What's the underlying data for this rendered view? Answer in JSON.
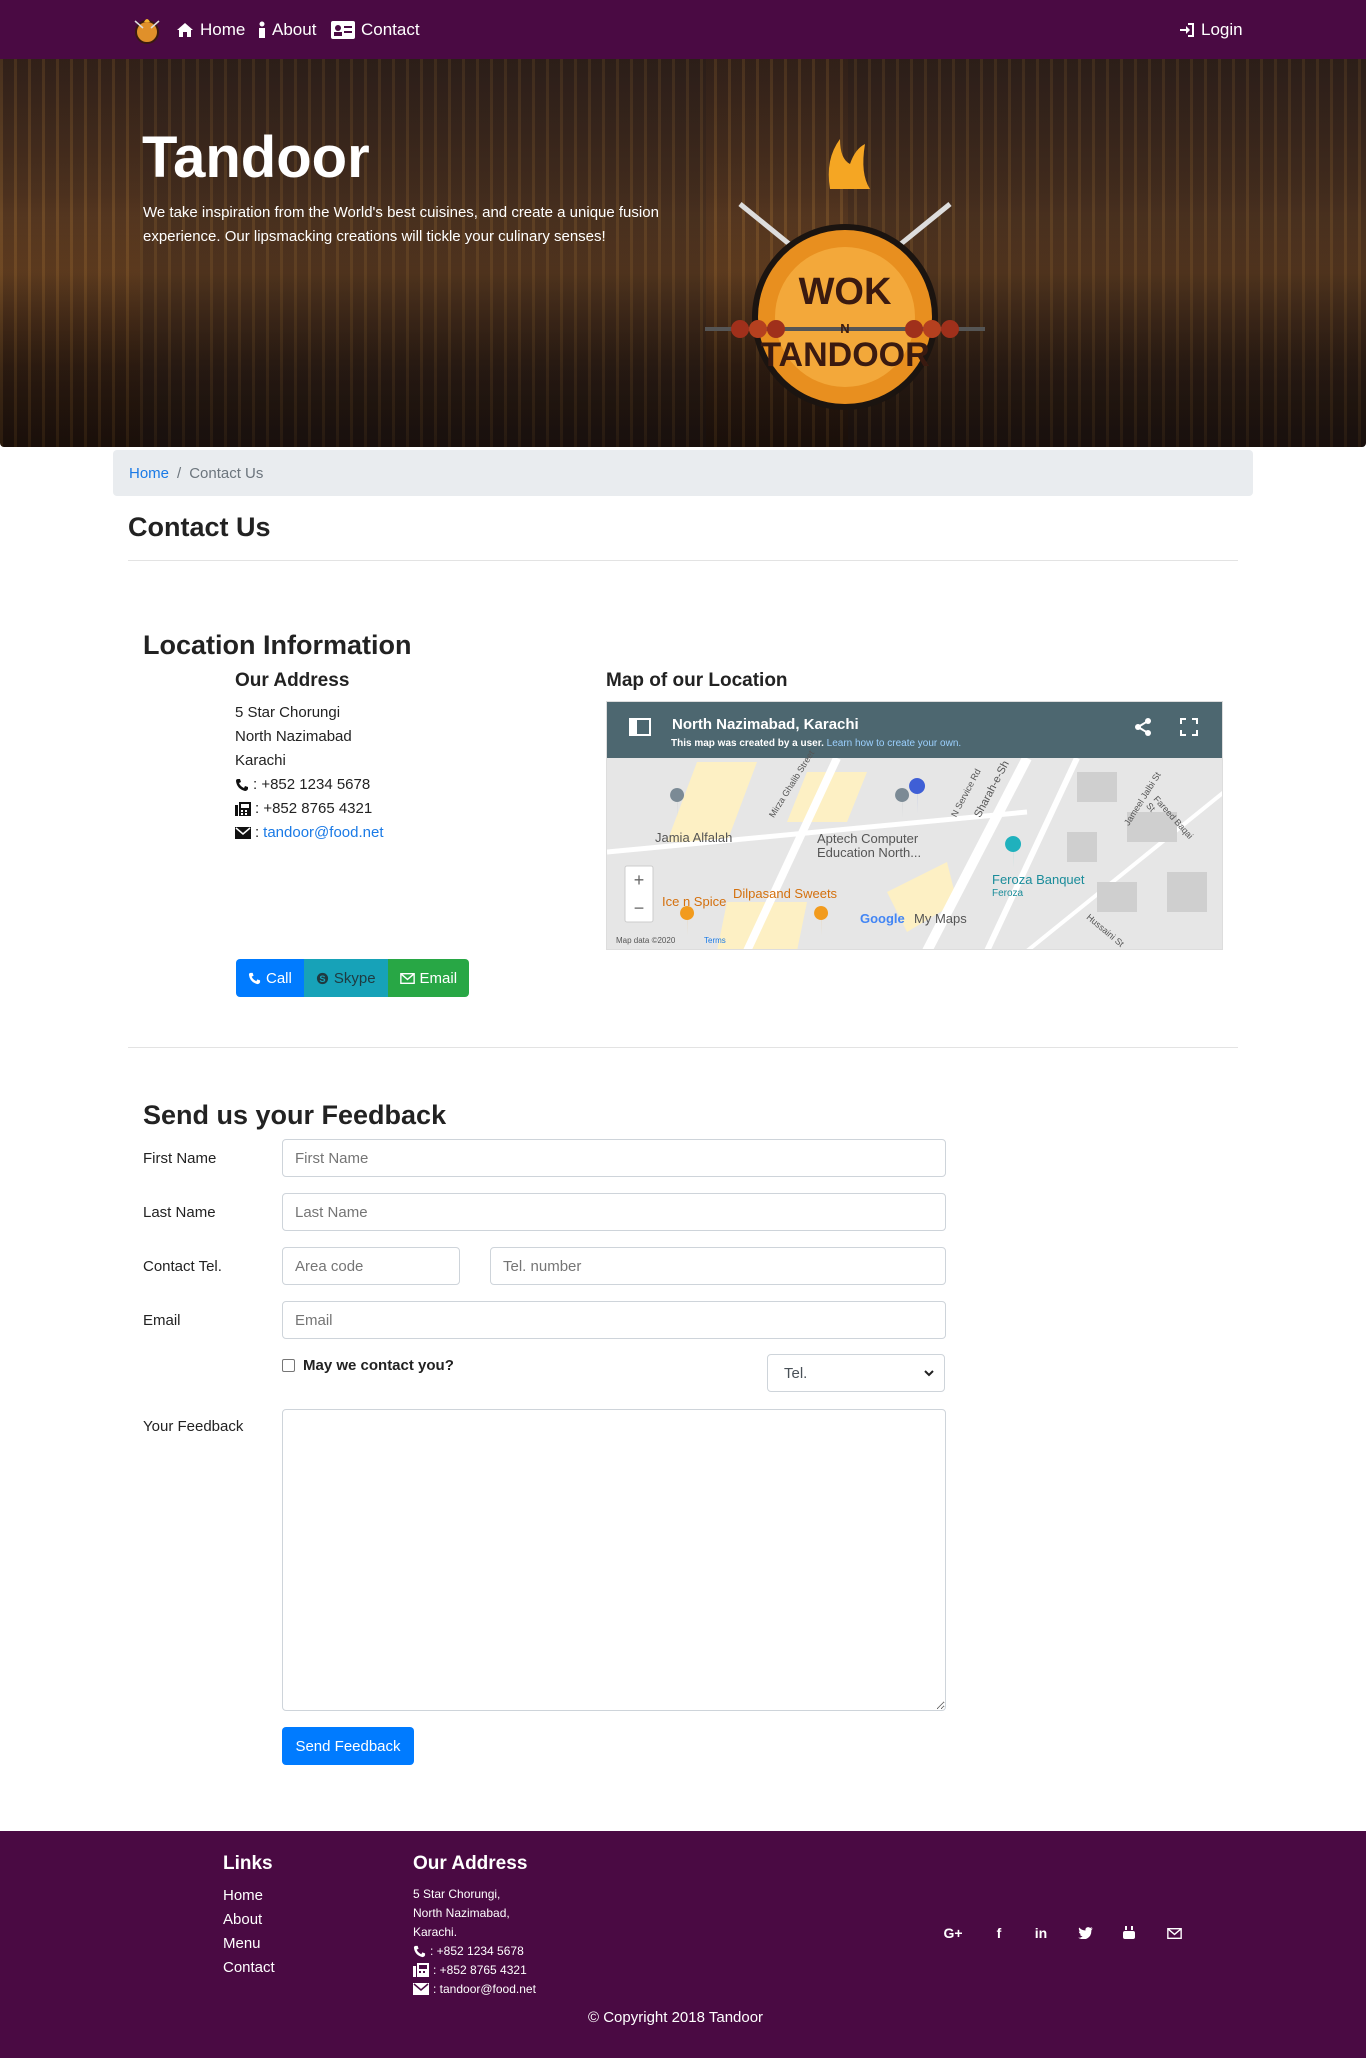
{
  "nav": {
    "home": "Home",
    "about": "About",
    "contact": "Contact",
    "login": "Login"
  },
  "hero": {
    "title": "Tandoor",
    "description": "We take inspiration from the World's best cuisines, and create a unique fusion experience. Our lipsmacking creations will tickle your culinary senses!",
    "logo_text_top": "WOK",
    "logo_text_mid": "N",
    "logo_text_bottom": "TANDOOR"
  },
  "breadcrumb": {
    "home": "Home",
    "current": "Contact Us"
  },
  "page_title": "Contact Us",
  "location": {
    "title": "Location Information",
    "address_title": "Our Address",
    "address_lines": [
      "5 Star Chorungi",
      "North Nazimabad",
      "Karachi"
    ],
    "phone": ": +852 1234 5678",
    "fax": ": +852 8765 4321",
    "email_prefix": ":",
    "email": "tandoor@food.net",
    "buttons": {
      "call": "Call",
      "skype": "Skype",
      "email": "Email"
    },
    "map_title": "Map of our Location",
    "map": {
      "header_title": "North Nazimabad, Karachi",
      "header_note": "This map was created by a user.",
      "header_link": "Learn how to create your own.",
      "labels": {
        "jamia": "Jamia Alfalah",
        "aptech": "Aptech Computer Education North...",
        "ice": "Ice n Spice",
        "dilpasand": "Dilpasand Sweets",
        "feroza": "Feroza Banquet",
        "feroza_sub": "Feroza",
        "mirza": "Mirza Ghalib Street",
        "service": "N Service Rd",
        "sharah": "Sharah-e-Sh",
        "jameel": "Jameel Jalbi St",
        "fareed": "Fareed Baqai St",
        "hussaini": "Hussaini St",
        "google": "Google",
        "mymaps": "My Maps",
        "mapdata": "Map data ©2020",
        "terms": "Terms"
      }
    }
  },
  "feedback": {
    "title": "Send us your Feedback",
    "first_name_label": "First Name",
    "first_name_placeholder": "First Name",
    "last_name_label": "Last Name",
    "last_name_placeholder": "Last Name",
    "tel_label": "Contact Tel.",
    "area_placeholder": "Area code",
    "tel_placeholder": "Tel. number",
    "email_label": "Email",
    "email_placeholder": "Email",
    "contact_check": "May we contact you?",
    "contact_method": "Tel.",
    "feedback_label": "Your Feedback",
    "send_button": "Send Feedback"
  },
  "footer": {
    "links_title": "Links",
    "links": [
      "Home",
      "About",
      "Menu",
      "Contact"
    ],
    "address_title": "Our Address",
    "address_lines": [
      "5 Star Chorungi,",
      "North Nazimabad,",
      "Karachi."
    ],
    "phone": ": +852 1234 5678",
    "fax": ": +852 8765 4321",
    "email": ": tandoor@food.net",
    "social": {
      "google": "G+",
      "facebook": "f",
      "linkedin": "in"
    },
    "copyright": "© Copyright 2018 Tandoor"
  },
  "colors": {
    "brand_purple": "#4a0a43",
    "link_blue": "#1a7ae6",
    "primary": "#007bff",
    "info": "#17a2b8",
    "success": "#28a745"
  }
}
